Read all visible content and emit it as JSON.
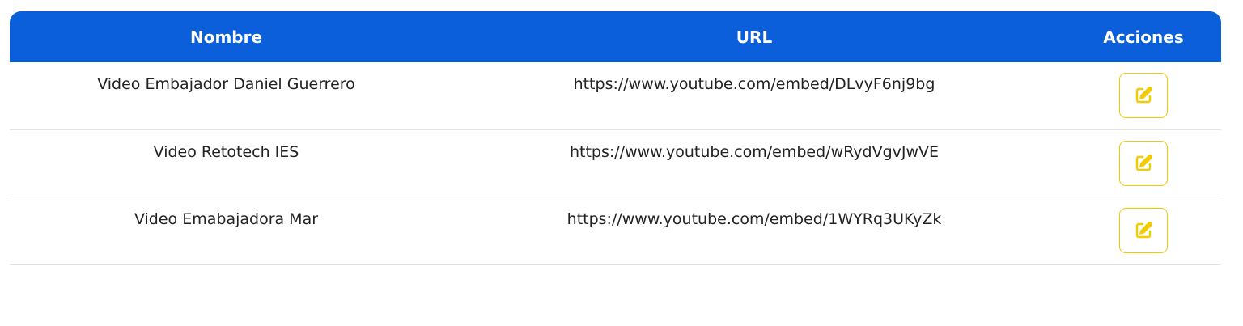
{
  "table": {
    "headers": {
      "name": "Nombre",
      "url": "URL",
      "actions": "Acciones"
    },
    "rows": [
      {
        "name": "Video Embajador Daniel Guerrero",
        "url": "https://www.youtube.com/embed/DLvyF6nj9bg"
      },
      {
        "name": "Video Retotech IES",
        "url": "https://www.youtube.com/embed/wRydVgvJwVE"
      },
      {
        "name": "Video Emabajadora Mar",
        "url": "https://www.youtube.com/embed/1WYRq3UKyZk"
      }
    ]
  },
  "icons": {
    "edit": "edit-icon"
  },
  "colors": {
    "header_bg": "#0c5fdb",
    "edit_accent": "#f2cc00"
  }
}
